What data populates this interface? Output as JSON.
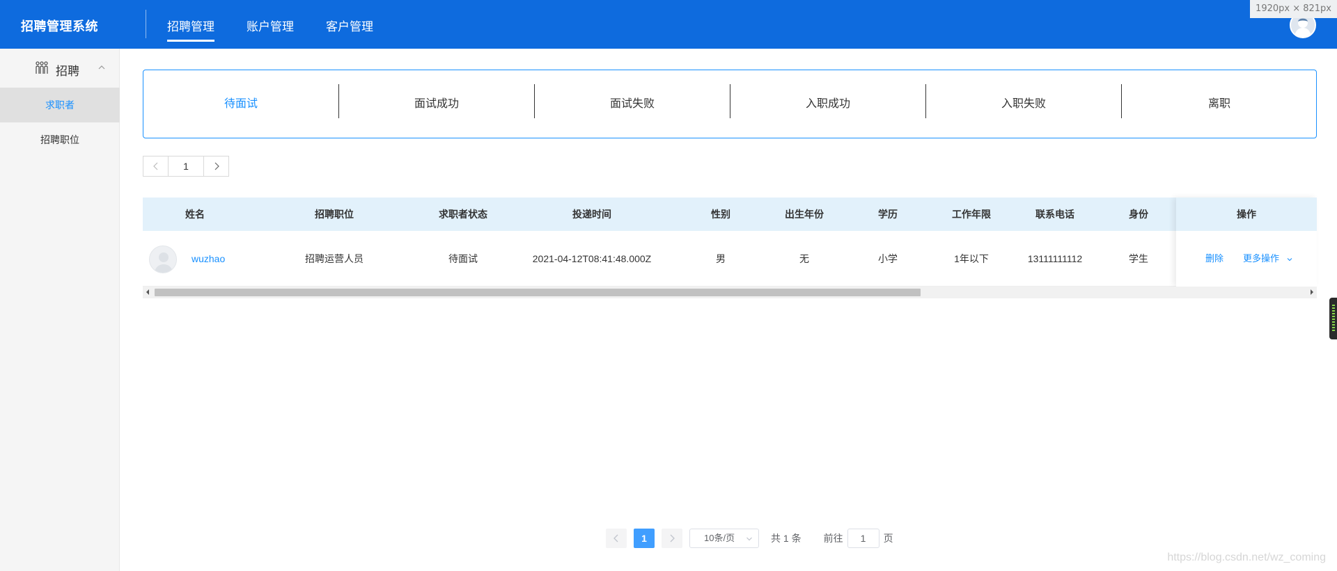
{
  "header": {
    "brand": "招聘管理系统",
    "nav": [
      {
        "label": "招聘管理",
        "active": true
      },
      {
        "label": "账户管理",
        "active": false
      },
      {
        "label": "客户管理",
        "active": false
      }
    ],
    "size_badge": "1920px × 821px"
  },
  "sidebar": {
    "group_label": "招聘",
    "group_icon": "people-icon",
    "items": [
      {
        "label": "求职者",
        "active": true
      },
      {
        "label": "招聘职位",
        "active": false
      }
    ]
  },
  "status_tabs": [
    {
      "label": "待面试",
      "active": true
    },
    {
      "label": "面试成功",
      "active": false
    },
    {
      "label": "面试失败",
      "active": false
    },
    {
      "label": "入职成功",
      "active": false
    },
    {
      "label": "入职失败",
      "active": false
    },
    {
      "label": "离职",
      "active": false
    }
  ],
  "mini_pager": {
    "page": "1"
  },
  "table": {
    "columns": [
      "姓名",
      "招聘职位",
      "求职者状态",
      "投递时间",
      "性别",
      "出生年份",
      "学历",
      "工作年限",
      "联系电话",
      "身份",
      "操作"
    ],
    "rows": [
      {
        "name": "wuzhao",
        "position": "招聘运营人员",
        "status": "待面试",
        "submit_time": "2021-04-12T08:41:48.000Z",
        "gender": "男",
        "birth_year": "无",
        "education": "小学",
        "work_years": "1年以下",
        "phone": "13111111112",
        "identity": "学生",
        "actions": {
          "delete": "删除",
          "more": "更多操作"
        }
      }
    ]
  },
  "pagination": {
    "current_page": "1",
    "page_size": "10条/页",
    "total": "共 1 条",
    "goto_prefix": "前往",
    "goto_value": "1",
    "goto_suffix": "页"
  },
  "watermark": "https://blog.csdn.net/wz_coming",
  "colors": {
    "header_bg": "#0e6bde",
    "accent": "#1890ff",
    "table_header_bg": "#e2f1fb",
    "pager_active": "#409eff"
  }
}
